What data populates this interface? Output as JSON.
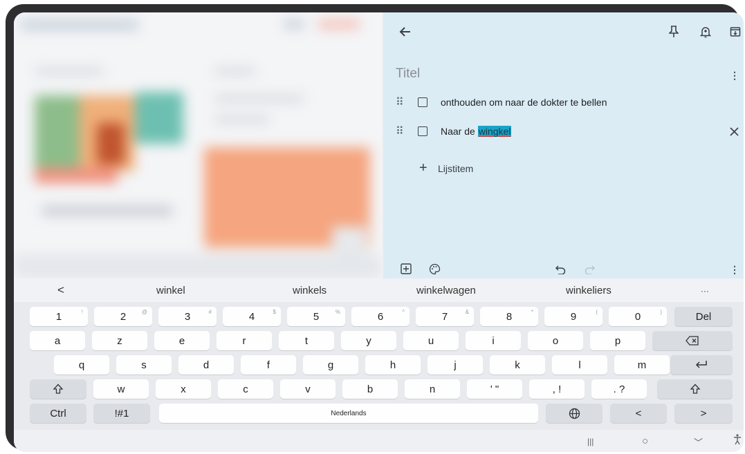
{
  "note": {
    "title_placeholder": "Titel",
    "items": [
      {
        "text": "onthouden om naar de dokter te bellen"
      },
      {
        "text_before": "Naar de ",
        "text_selected": "wingkel"
      }
    ],
    "add_item_label": "Lijstitem"
  },
  "suggestions": {
    "back": "<",
    "items": [
      "winkel",
      "winkels",
      "winkelwagen",
      "winkeliers"
    ],
    "more": "···"
  },
  "keyboard": {
    "row1": [
      {
        "label": "1",
        "sup": "!"
      },
      {
        "label": "2",
        "sup": "@"
      },
      {
        "label": "3",
        "sup": "#"
      },
      {
        "label": "4",
        "sup": "$"
      },
      {
        "label": "5",
        "sup": "%"
      },
      {
        "label": "6",
        "sup": "^"
      },
      {
        "label": "7",
        "sup": "&"
      },
      {
        "label": "8",
        "sup": "*"
      },
      {
        "label": "9",
        "sup": "("
      },
      {
        "label": "0",
        "sup": ")"
      },
      {
        "label": "Del",
        "sup": ""
      }
    ],
    "row2": [
      "a",
      "z",
      "e",
      "r",
      "t",
      "y",
      "u",
      "i",
      "o",
      "p"
    ],
    "row3": [
      "q",
      "s",
      "d",
      "f",
      "g",
      "h",
      "j",
      "k",
      "l",
      "m"
    ],
    "row4": [
      {
        "label": "w"
      },
      {
        "label": "x"
      },
      {
        "label": "c"
      },
      {
        "label": "v"
      },
      {
        "label": "b"
      },
      {
        "label": "n"
      },
      {
        "label": "'  \""
      },
      {
        "label": ",  !"
      },
      {
        "label": ".  ?"
      }
    ],
    "ctrl": "Ctrl",
    "symbols": "!#1",
    "space_label": "Nederlands",
    "left_arrow": "<",
    "right_arrow": ">"
  },
  "navbar": {
    "recents": "|||",
    "home": "○",
    "back": "﹀"
  },
  "colors": {
    "notes_bg": "#dcecf5",
    "selection": "#1aa3c7",
    "keyboard_bg": "#e8eaee"
  }
}
